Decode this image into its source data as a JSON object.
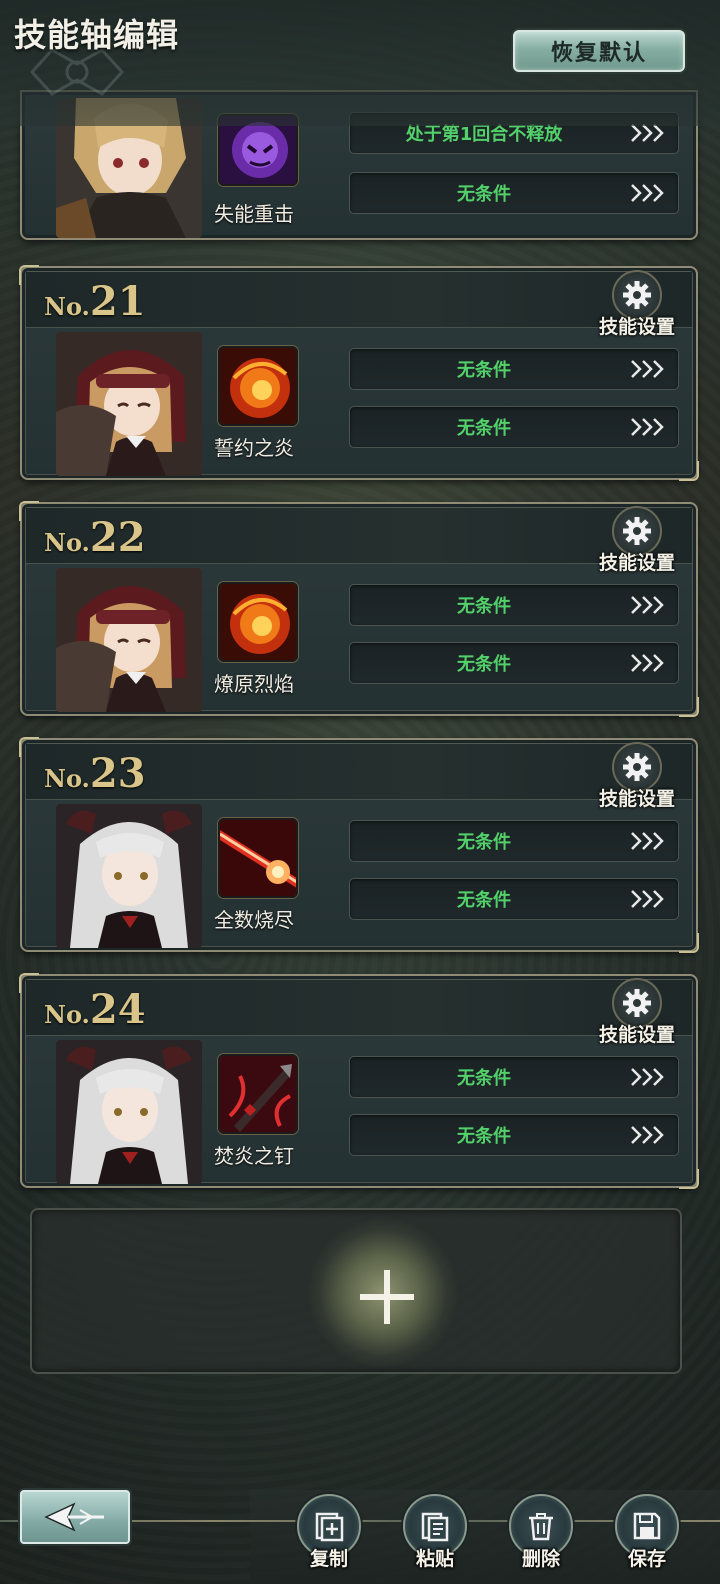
{
  "header": {
    "title": "技能轴编辑",
    "reset_label": "恢复默认"
  },
  "partial_card": {
    "skill_name": "失能重击",
    "conditions": [
      "处于第1回合不释放",
      "无条件"
    ]
  },
  "cards": [
    {
      "no_prefix": "No.",
      "number": "21",
      "settings_label": "技能设置",
      "skill_name": "誓约之炎",
      "conditions": [
        "无条件",
        "无条件"
      ]
    },
    {
      "no_prefix": "No.",
      "number": "22",
      "settings_label": "技能设置",
      "skill_name": "燎原烈焰",
      "conditions": [
        "无条件",
        "无条件"
      ]
    },
    {
      "no_prefix": "No.",
      "number": "23",
      "settings_label": "技能设置",
      "skill_name": "全数烧尽",
      "conditions": [
        "无条件",
        "无条件"
      ]
    },
    {
      "no_prefix": "No.",
      "number": "24",
      "settings_label": "技能设置",
      "skill_name": "焚炎之钉",
      "conditions": [
        "无条件",
        "无条件"
      ]
    }
  ],
  "toolbar": {
    "copy_label": "复制",
    "paste_label": "粘贴",
    "delete_label": "删除",
    "save_label": "保存"
  },
  "colors": {
    "condition_text": "#52d06a",
    "number_gold": "#d9c58a",
    "accent_teal": "#86aea3"
  }
}
